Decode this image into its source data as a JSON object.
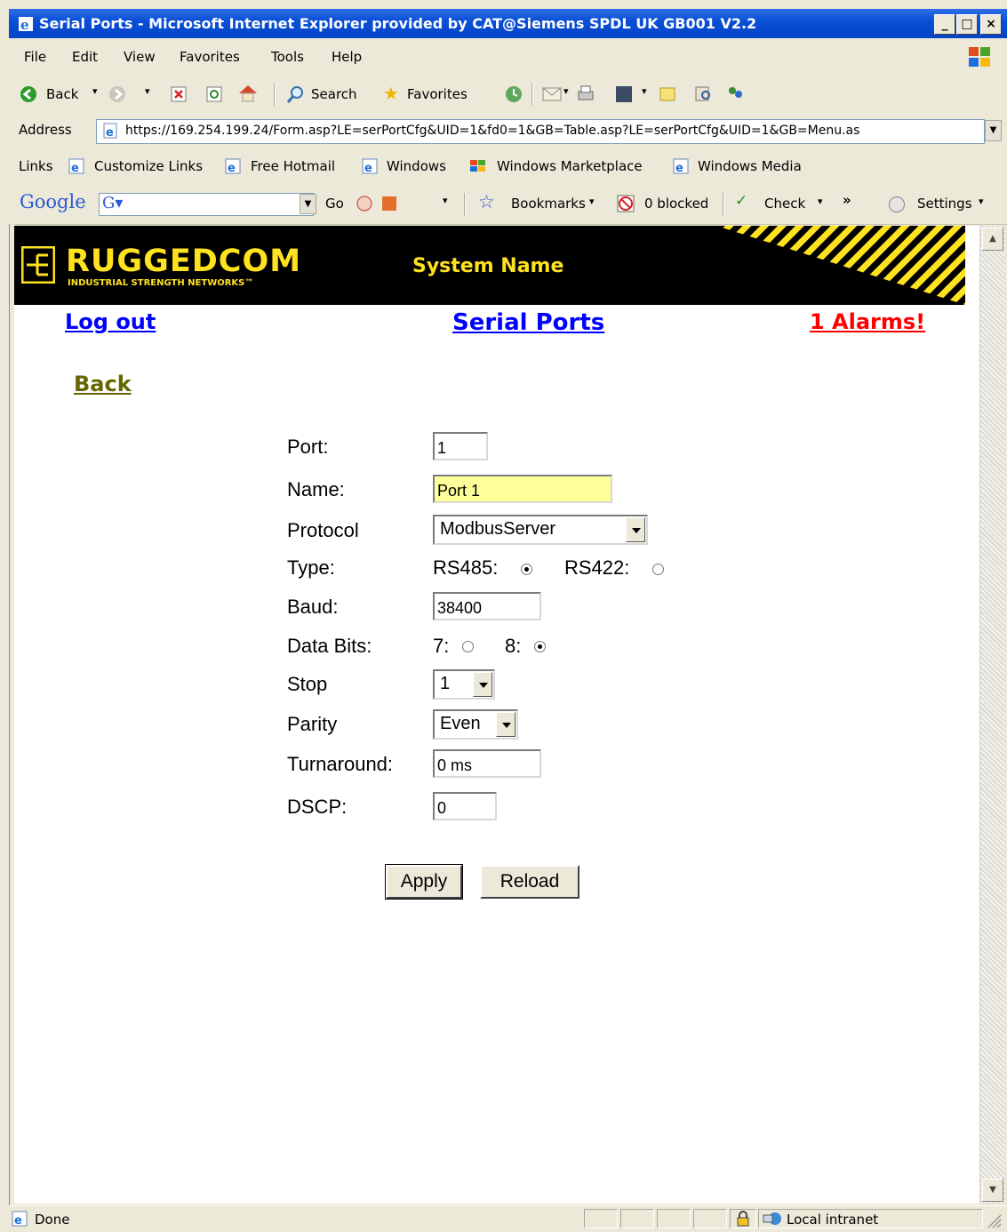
{
  "window": {
    "title": "Serial Ports - Microsoft Internet Explorer provided by CAT@Siemens SPDL UK GB001 V2.2",
    "min": "_",
    "max": "□",
    "close": "×"
  },
  "menu": [
    "File",
    "Edit",
    "View",
    "Favorites",
    "Tools",
    "Help"
  ],
  "toolbar": {
    "back": "Back",
    "search": "Search",
    "favorites": "Favorites"
  },
  "address": {
    "label": "Address",
    "url": "https://169.254.199.24/Form.asp?LE=serPortCfg&UID=1&fd0=1&GB=Table.asp?LE=serPortCfg&UID=1&GB=Menu.as"
  },
  "links": {
    "label": "Links",
    "items": [
      "Customize Links",
      "Free Hotmail",
      "Windows",
      "Windows Marketplace",
      "Windows Media"
    ]
  },
  "google": {
    "logo": "Google",
    "go": "Go",
    "bookmarks": "Bookmarks",
    "blocked": "0 blocked",
    "check": "Check",
    "settings": "Settings",
    "more": "»"
  },
  "page": {
    "brand": "RUGGEDCOM",
    "brand_sub": "INDUSTRIAL STRENGTH NETWORKS™",
    "system_name": "System Name",
    "logout": "Log out",
    "heading": "Serial Ports",
    "alarms": "1 Alarms!",
    "back": "Back"
  },
  "form": {
    "port_label": "Port:",
    "port_value": "1",
    "name_label": "Name:",
    "name_value": "Port 1",
    "protocol_label": "Protocol",
    "protocol_value": "ModbusServer",
    "type_label": "Type:",
    "type_rs485": "RS485:",
    "type_rs422": "RS422:",
    "type_selected": "RS485",
    "baud_label": "Baud:",
    "baud_value": "38400",
    "databits_label": "Data Bits:",
    "databits_7": "7:",
    "databits_8": "8:",
    "databits_selected": "8",
    "stop_label": "Stop",
    "stop_value": "1",
    "parity_label": "Parity",
    "parity_value": "Even",
    "turnaround_label": "Turnaround:",
    "turnaround_value": "0 ms",
    "dscp_label": "DSCP:",
    "dscp_value": "0",
    "apply": "Apply",
    "reload": "Reload"
  },
  "status": {
    "text": "Done",
    "zone": "Local intranet"
  },
  "colors": {
    "link_blue": "#0000ff",
    "alarm_red": "#ff0000",
    "back_olive": "#666600",
    "brand_yellow": "#ffe21f",
    "name_field_bg": "#ffff99"
  }
}
